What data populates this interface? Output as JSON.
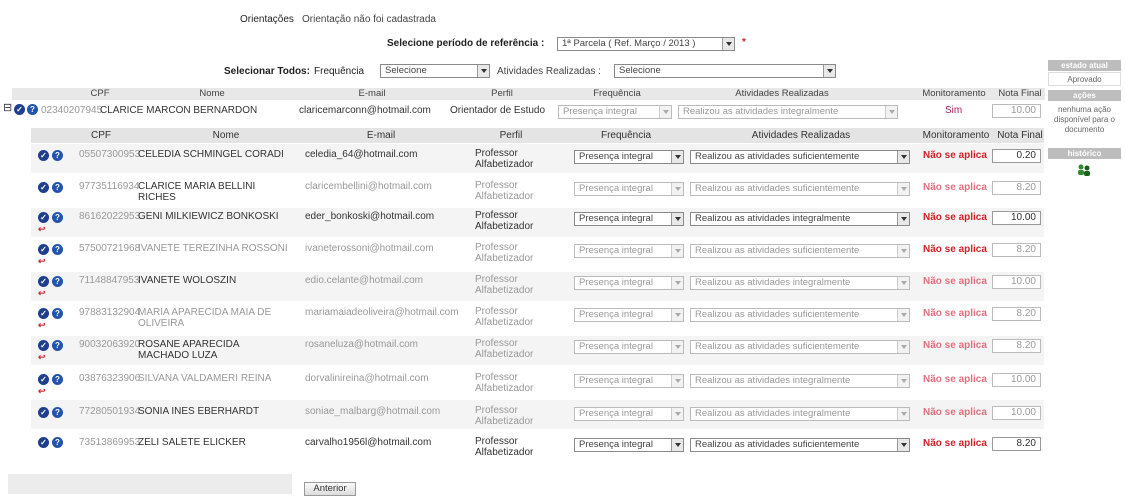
{
  "top": {
    "orient_label": "Orientações",
    "orient_value": "Orientação não foi cadastrada",
    "period_label": "Selecione período de referência :",
    "period_value": "1ª Parcela ( Ref. Março / 2013 )",
    "required_mark": "*",
    "select_all_label": "Selecionar Todos:",
    "freq_label": "Frequência",
    "freq_value": "Selecione",
    "activities_label": "Atividades Realizadas :",
    "activities_value": "Selecione"
  },
  "outer_table": {
    "headers": [
      "CPF",
      "Nome",
      "E-mail",
      "Perfil",
      "Frequência",
      "Atividades Realizadas",
      "Monitoramento",
      "Nota Final"
    ],
    "row": {
      "toggle": "⊟",
      "cpf": "02340207945",
      "name": "CLARICE MARCON BERNARDON",
      "email": "claricemarconn@hotmail.com",
      "profile": "Orientador de Estudo",
      "frequency": "Presença integral",
      "activities": "Realizou as atividades integralmente",
      "monitoring": "Sim",
      "grade": "10.00"
    }
  },
  "inner_table": {
    "headers": [
      "CPF",
      "Nome",
      "E-mail",
      "Perfil",
      "Frequência",
      "Atividades Realizadas",
      "Monitoramento",
      "Nota Final"
    ],
    "rows": [
      {
        "cpf": "05507300953",
        "name": "CELEDIA SCHMINGEL CORADI",
        "email": "celedia_64@hotmail.com",
        "profile": "Professor Alfabetizador",
        "frequency": "Presença integral",
        "activities": "Realizou as atividades suficientemente",
        "monitoring": "Não se aplica",
        "grade": "0.20"
      },
      {
        "cpf": "97735116934",
        "name": "CLARICE MARIA BELLINI RICHES",
        "email": "claricembellini@hotmail.com",
        "profile": "Professor Alfabetizador",
        "frequency": "Presença integral",
        "activities": "Realizou as atividades suficientemente",
        "monitoring": "Não se aplica",
        "grade": "8.20"
      },
      {
        "cpf": "86162022953",
        "name": "GENI MILKIEWICZ BONKOSKI",
        "email": "eder_bonkoski@hotmail.com",
        "profile": "Professor Alfabetizador",
        "frequency": "Presença integral",
        "activities": "Realizou as atividades integralmente",
        "monitoring": "Não se aplica",
        "grade": "10.00"
      },
      {
        "cpf": "57500721968",
        "name": "IVANETE TEREZINHA ROSSONI",
        "email": "ivaneterossoni@hotmail.com",
        "profile": "Professor Alfabetizador",
        "frequency": "Presença integral",
        "activities": "Realizou as atividades suficientemente",
        "monitoring": "Não se aplica",
        "grade": "8.20"
      },
      {
        "cpf": "71148847953",
        "name": "IVANETE WOLOSZIN",
        "email": "edio.celante@hotmail.com",
        "profile": "Professor Alfabetizador",
        "frequency": "Presença integral",
        "activities": "Realizou as atividades integralmente",
        "monitoring": "Não se aplica",
        "grade": "10.00"
      },
      {
        "cpf": "97883132904",
        "name": "MARIA APARECIDA MAIA DE OLIVEIRA",
        "email": "mariamaiadeoliveira@hotmail.com",
        "profile": "Professor Alfabetizador",
        "frequency": "Presença integral",
        "activities": "Realizou as atividades suficientemente",
        "monitoring": "Não se aplica",
        "grade": "8.20"
      },
      {
        "cpf": "90032063920",
        "name": "ROSANE APARECIDA MACHADO LUZA",
        "email": "rosaneluza@hotmail.com",
        "profile": "Professor Alfabetizador",
        "frequency": "Presença integral",
        "activities": "Realizou as atividades suficientemente",
        "monitoring": "Não se aplica",
        "grade": "8.20"
      },
      {
        "cpf": "03876323906",
        "name": "SILVANA VALDAMERI REINA",
        "email": "dorvalinireina@hotmail.com",
        "profile": "Professor Alfabetizador",
        "frequency": "Presença integral",
        "activities": "Realizou as atividades integralmente",
        "monitoring": "Não se aplica",
        "grade": "10.00"
      },
      {
        "cpf": "77280501934",
        "name": "SONIA INES EBERHARDT",
        "email": "soniae_malbarg@hotmail.com",
        "profile": "Professor Alfabetizador",
        "frequency": "Presença integral",
        "activities": "Realizou as atividades integralmente",
        "monitoring": "Não se aplica",
        "grade": "10.00"
      },
      {
        "cpf": "73513869953",
        "name": "ZELI SALETE ELICKER",
        "email": "carvalho1956l@hotmail.com",
        "profile": "Professor Alfabetizador",
        "frequency": "Presença integral",
        "activities": "Realizou as atividades suficientemente",
        "monitoring": "Não se aplica",
        "grade": "8.20"
      }
    ]
  },
  "sidebar": {
    "state_title": "estado atual",
    "state_value": "Aprovado",
    "actions_title": "ações",
    "action_note": "nenhuma ação disponível para o documento",
    "history_title": "histórico"
  },
  "footer": {
    "back_button": "Anterior"
  }
}
